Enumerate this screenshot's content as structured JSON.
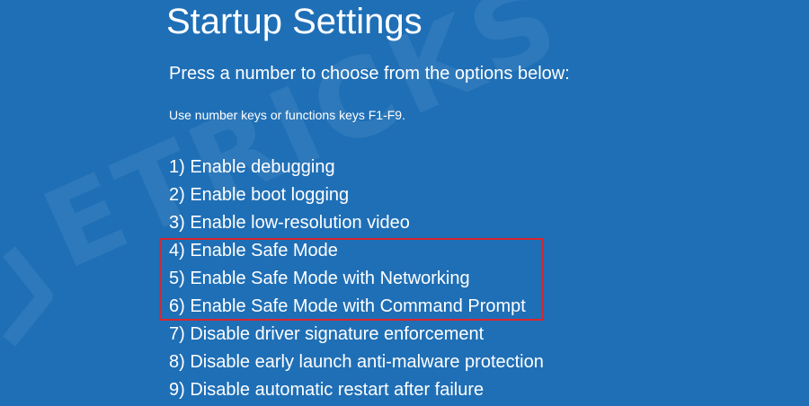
{
  "screen": {
    "title": "Startup Settings",
    "prompt": "Press a number to choose from the options below:",
    "hint": "Use number keys or functions keys F1-F9.",
    "options": [
      {
        "label": "1) Enable debugging"
      },
      {
        "label": "2) Enable boot logging"
      },
      {
        "label": "3) Enable low-resolution video"
      },
      {
        "label": "4) Enable Safe Mode"
      },
      {
        "label": "5) Enable Safe Mode with Networking"
      },
      {
        "label": "6) Enable Safe Mode with Command Prompt"
      },
      {
        "label": "7) Disable driver signature enforcement"
      },
      {
        "label": "8) Disable early launch anti-malware protection"
      },
      {
        "label": "9) Disable automatic restart after failure"
      }
    ],
    "highlighted_options": [
      4,
      5,
      6
    ]
  },
  "watermark": {
    "text": "ETRICKS",
    "logo": "watermark-logo"
  },
  "colors": {
    "background": "#1f6fb6",
    "text": "#ffffff",
    "highlight_border": "#d8262e"
  }
}
